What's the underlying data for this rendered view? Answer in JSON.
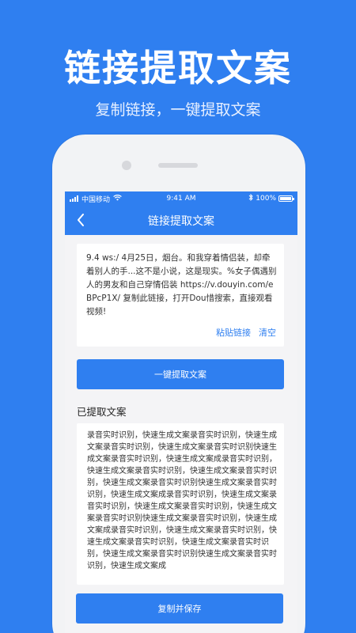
{
  "hero": {
    "title": "链接提取文案",
    "subtitle": "复制链接，一键提取文案"
  },
  "status_bar": {
    "carrier": "中国移动",
    "time": "9:41 AM",
    "battery": "100%"
  },
  "nav": {
    "title": "链接提取文案",
    "back_icon": "chevron-left-icon"
  },
  "input": {
    "text": "9.4 ws:/ 4月25日，烟台。和我穿着情侣装，却牵着别人的手...这不是小说，这是现实。%女子偶遇别人的男友和自己穿情侣装  https://v.douyin.com/eBPcP1X/ 复制此链接，打开Dou惜搜索，直接观看视频!",
    "paste_label": "粘贴链接",
    "clear_label": "清空"
  },
  "extract_button": "一键提取文案",
  "result": {
    "heading": "已提取文案",
    "text": "录音实时识别，快速生成文案录音实时识别，快速生成文案录音实时识别，快速生成文案录音实时识别快速生成文案录音实时识别，快速生成文案成录音实时识别，快速生成文案录音实时识别，快速生成文案录音实时识别，快速生成文案录音实时识别快速生成文案录音实时识别，快速生成文案成录音实时识别，快速生成文案录音实时识别，快速生成文案录音实时识别，快速生成文案录音实时识别快速生成文案录音实时识别，快速生成文案成录音实时识别，快速生成文案录音实时识别，快速生成文案录音实时识别，快速生成文案录音实时识别，快速生成文案录音实时识别快速生成文案录音实时识别，快速生成文案成"
  },
  "save_button": "复制并保存",
  "colors": {
    "accent": "#2f7ff0",
    "background": "#f4f4f6"
  }
}
